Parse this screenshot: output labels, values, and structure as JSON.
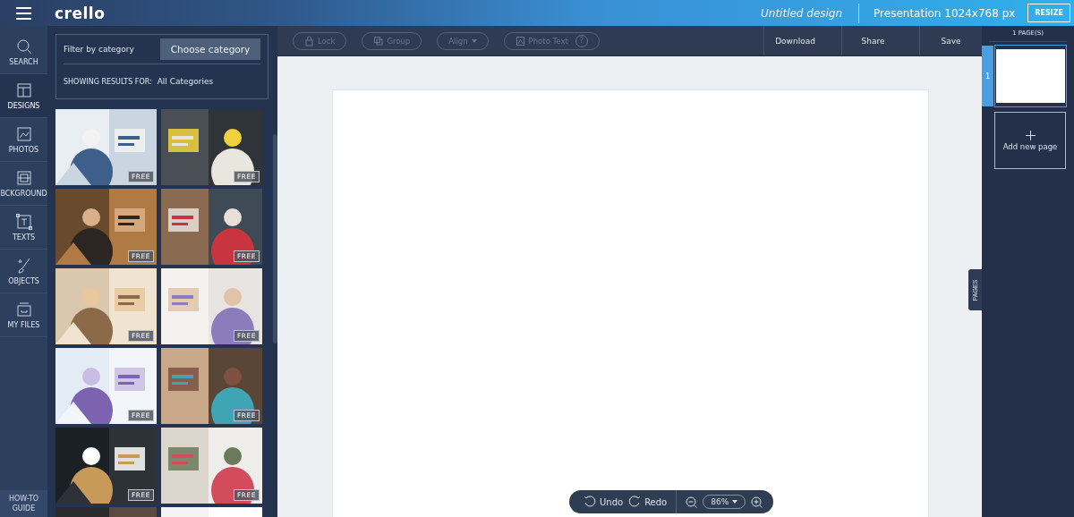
{
  "topbar": {
    "logo": "crello",
    "document_title": "Untitled design",
    "format": "Presentation 1024x768 px",
    "resize_button": "RESIZE"
  },
  "sidebar": {
    "items": [
      {
        "label": "SEARCH",
        "kind": "search",
        "selected": false
      },
      {
        "label": "DESIGNS",
        "kind": "designs",
        "selected": true
      },
      {
        "label": "PHOTOS",
        "kind": "photos",
        "selected": false
      },
      {
        "label": "BCKGROUND",
        "kind": "background",
        "selected": false
      },
      {
        "label": "TEXTS",
        "kind": "texts",
        "selected": false
      },
      {
        "label": "OBJECTS",
        "kind": "objects",
        "selected": false
      },
      {
        "label": "MY FILES",
        "kind": "files",
        "selected": false
      }
    ],
    "guide": "HOW-TO GUIDE"
  },
  "filter": {
    "label": "Filter by category",
    "button": "Choose category",
    "results_label": "SHOWING RESULTS FOR:",
    "results_value": "All Categories"
  },
  "templates": [
    {
      "kind": "picture",
      "badge": "FREE"
    },
    {
      "kind": "picture",
      "badge": "FREE"
    },
    {
      "kind": "picture",
      "badge": "FREE"
    },
    {
      "kind": "picture",
      "badge": "FREE"
    },
    {
      "kind": "picture",
      "badge": "FREE"
    },
    {
      "kind": "picture",
      "badge": "FREE"
    },
    {
      "kind": "picture",
      "badge": "FREE"
    },
    {
      "kind": "picture",
      "badge": "FREE"
    },
    {
      "kind": "picture",
      "badge": "FREE"
    },
    {
      "kind": "picture",
      "badge": "FREE"
    },
    {
      "kind": "picture"
    },
    {
      "kind": "picture"
    }
  ],
  "toolbar": {
    "tools": [
      {
        "label": "Lock",
        "kind": "lock",
        "disabled": true
      },
      {
        "label": "Group",
        "kind": "group",
        "disabled": true
      },
      {
        "label": "Align",
        "kind": "align",
        "disabled": true
      },
      {
        "label": "Photo Text",
        "kind": "phototext",
        "disabled": true,
        "help": "?"
      }
    ],
    "actions": [
      "Download",
      "Share",
      "Save"
    ]
  },
  "zoom_bar": {
    "undo": "Undo",
    "redo": "Redo",
    "zoom": "86%"
  },
  "pages": {
    "count": "1 PAGE(S)",
    "thumbnails": [
      {
        "number": "1",
        "selected": true
      }
    ],
    "add_button": "Add new page",
    "tab": "PAGES"
  }
}
